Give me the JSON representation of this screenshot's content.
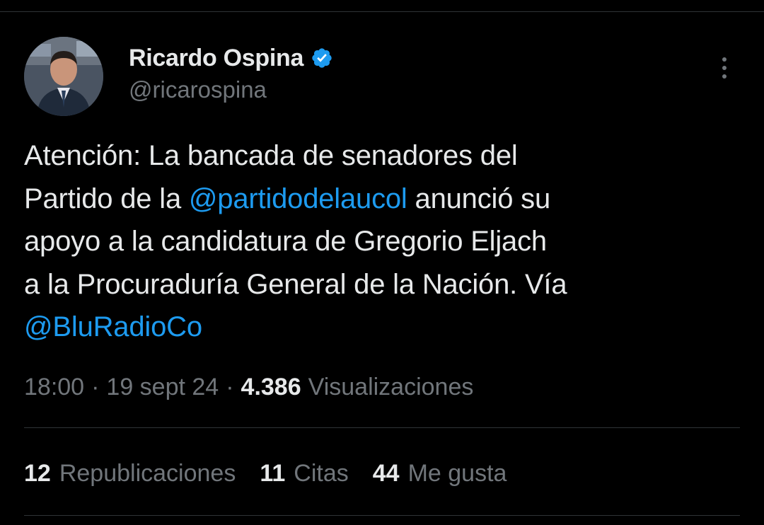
{
  "author": {
    "name": "Ricardo Ospina",
    "handle": "@ricarospina",
    "verified": true,
    "avatar": "profile-photo"
  },
  "tweet": {
    "line1": "Atención: La bancada de senadores del",
    "line2_prefix": "Partido de la ",
    "mention1": "@partidodelaucol",
    "line2_suffix": " anunció su",
    "line3": "apoyo a la candidatura de Gregorio Eljach",
    "line4": "a la Procuraduría General de la Nación. Vía",
    "mention2": "@BluRadioCo"
  },
  "meta": {
    "time": "18:00",
    "separator": "·",
    "date": "19 sept 24",
    "views_count": "4.386",
    "views_label": "Visualizaciones"
  },
  "stats": {
    "reposts_count": "12",
    "reposts_label": "Republicaciones",
    "quotes_count": "11",
    "quotes_label": "Citas",
    "likes_count": "44",
    "likes_label": "Me gusta"
  },
  "colors": {
    "background": "#000000",
    "text": "#e7e9ea",
    "secondary": "#71767b",
    "accent": "#1d9bf0",
    "divider": "#2f3336"
  },
  "icons": {
    "verified": "verified-badge-icon",
    "more": "more-vertical-icon"
  }
}
